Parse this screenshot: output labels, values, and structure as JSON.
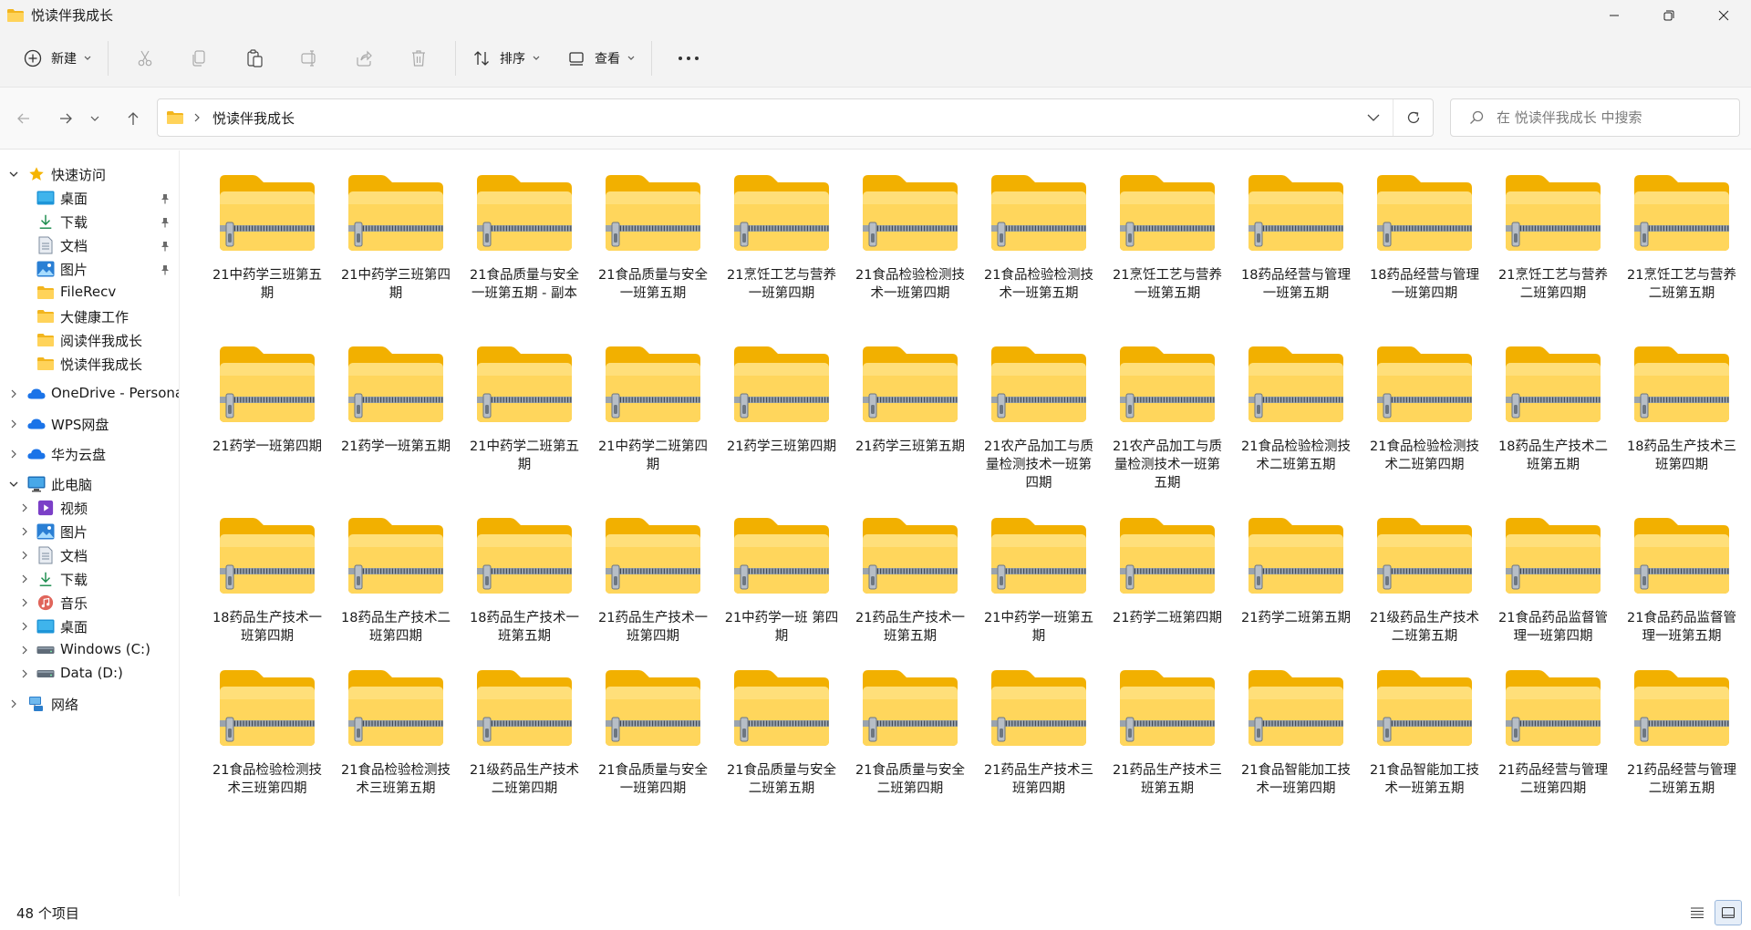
{
  "window": {
    "title": "悦读伴我成长"
  },
  "toolbar": {
    "new_label": "新建",
    "sort_label": "排序",
    "view_label": "查看"
  },
  "address": {
    "crumbs": [
      "悦读伴我成长"
    ]
  },
  "search": {
    "placeholder": "在 悦读伴我成长 中搜索"
  },
  "sidebar": {
    "items": [
      {
        "label": "快速访问",
        "icon": "star-icon",
        "level": 0,
        "expand": "down",
        "pin": false
      },
      {
        "label": "桌面",
        "icon": "desktop-icon",
        "level": 1,
        "expand": "",
        "pin": true
      },
      {
        "label": "下载",
        "icon": "download-icon",
        "level": 1,
        "expand": "",
        "pin": true
      },
      {
        "label": "文档",
        "icon": "document-icon",
        "level": 1,
        "expand": "",
        "pin": true
      },
      {
        "label": "图片",
        "icon": "pictures-icon",
        "level": 1,
        "expand": "",
        "pin": true
      },
      {
        "label": "FileRecv",
        "icon": "folder-icon",
        "level": 1,
        "expand": "",
        "pin": false
      },
      {
        "label": "大健康工作",
        "icon": "folder-icon",
        "level": 1,
        "expand": "",
        "pin": false
      },
      {
        "label": "阅读伴我成长",
        "icon": "folder-icon",
        "level": 1,
        "expand": "",
        "pin": false
      },
      {
        "label": "悦读伴我成长",
        "icon": "folder-icon",
        "level": 1,
        "expand": "",
        "pin": false
      },
      {
        "label": "OneDrive - Personal",
        "icon": "cloud-icon",
        "level": 0,
        "expand": "right",
        "pin": false
      },
      {
        "label": "WPS网盘",
        "icon": "cloud-icon",
        "level": 0,
        "expand": "right",
        "pin": false
      },
      {
        "label": "华为云盘",
        "icon": "cloud-icon",
        "level": 0,
        "expand": "right",
        "pin": false
      },
      {
        "label": "此电脑",
        "icon": "computer-icon",
        "level": 0,
        "expand": "down",
        "pin": false
      },
      {
        "label": "视频",
        "icon": "video-icon",
        "level": 1,
        "expand": "right",
        "pin": false
      },
      {
        "label": "图片",
        "icon": "pictures-icon",
        "level": 1,
        "expand": "right",
        "pin": false
      },
      {
        "label": "文档",
        "icon": "document-icon",
        "level": 1,
        "expand": "right",
        "pin": false
      },
      {
        "label": "下载",
        "icon": "download-icon",
        "level": 1,
        "expand": "right",
        "pin": false
      },
      {
        "label": "音乐",
        "icon": "music-icon",
        "level": 1,
        "expand": "right",
        "pin": false
      },
      {
        "label": "桌面",
        "icon": "desktop-icon",
        "level": 1,
        "expand": "right",
        "pin": false
      },
      {
        "label": "Windows (C:)",
        "icon": "drive-icon",
        "level": 1,
        "expand": "right",
        "pin": false
      },
      {
        "label": "Data (D:)",
        "icon": "drive-icon",
        "level": 1,
        "expand": "right",
        "pin": false
      },
      {
        "label": "网络",
        "icon": "network-icon",
        "level": 0,
        "expand": "right",
        "pin": false
      }
    ]
  },
  "files": [
    "21中药学三班第五期",
    "21中药学三班第四期",
    "21食品质量与安全一班第五期 - 副本",
    "21食品质量与安全一班第五期",
    "21烹饪工艺与营养一班第四期",
    "21食品检验检测技术一班第四期",
    "21食品检验检测技术一班第五期",
    "21烹饪工艺与营养一班第五期",
    "18药品经营与管理一班第五期",
    "18药品经营与管理一班第四期",
    "21烹饪工艺与营养二班第四期",
    "21烹饪工艺与营养二班第五期",
    "21药学一班第四期",
    "21药学一班第五期",
    "21中药学二班第五期",
    "21中药学二班第四期",
    "21药学三班第四期",
    "21药学三班第五期",
    "21农产品加工与质量检测技术一班第四期",
    "21农产品加工与质量检测技术一班第五期",
    "21食品检验检测技术二班第五期",
    "21食品检验检测技术二班第四期",
    "18药品生产技术二班第五期",
    "18药品生产技术三班第四期",
    "18药品生产技术一班第四期",
    "18药品生产技术二班第四期",
    "18药品生产技术一班第五期",
    "21药品生产技术一班第四期",
    "21中药学一班 第四期",
    "21药品生产技术一班第五期",
    "21中药学一班第五期",
    "21药学二班第四期",
    "21药学二班第五期",
    "21级药品生产技术二班第五期",
    "21食品药品监督管理一班第四期",
    "21食品药品监督管理一班第五期",
    "21食品检验检测技术三班第四期",
    "21食品检验检测技术三班第五期",
    "21级药品生产技术二班第四期",
    "21食品质量与安全一班第四期",
    "21食品质量与安全二班第五期",
    "21食品质量与安全二班第四期",
    "21药品生产技术三班第四期",
    "21药品生产技术三班第五期",
    "21食品智能加工技术一班第四期",
    "21食品智能加工技术一班第五期",
    "21药品经营与管理二班第四期",
    "21药品经营与管理二班第五期"
  ],
  "status": {
    "count_text": "48 个项目"
  },
  "colors": {
    "folder_back": "#f4b400",
    "folder_front": "#ffd75e",
    "accent": "#0067c0"
  }
}
